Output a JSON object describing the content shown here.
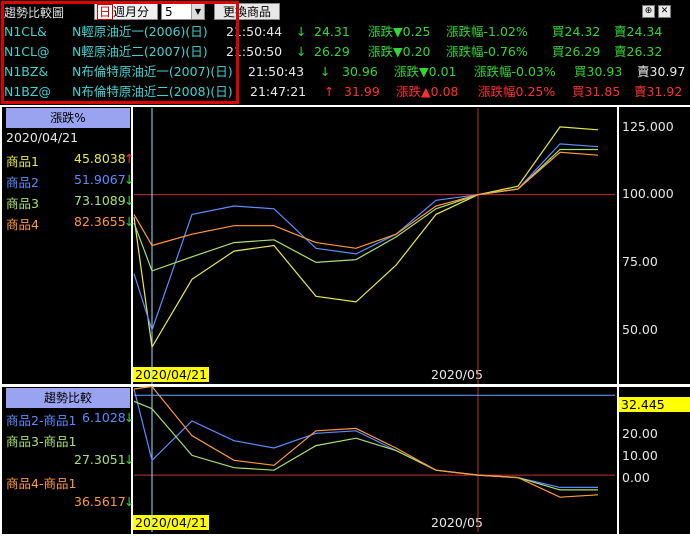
{
  "toolbar": {
    "title": "趨勢比較圖",
    "period_options": [
      "日",
      "週",
      "月",
      "分"
    ],
    "period_selected": "日",
    "count_value": "5",
    "change_button": "更換商品",
    "window_buttons": [
      "pin-icon",
      "close-icon"
    ]
  },
  "quotes": [
    {
      "code": "N1CL&",
      "name": "N輕原油近一(2006)(日)",
      "time": "21:50:44",
      "arrow": "↓",
      "price": "24.31",
      "chg_label": "漲跌",
      "chg_arrow": "▼",
      "chg": "0.25",
      "pct_label": "漲跌幅",
      "pct": "-1.02%",
      "bid_label": "買",
      "bid": "24.32",
      "ask_label": "賣",
      "ask": "24.34",
      "color": "green"
    },
    {
      "code": "N1CL@",
      "name": "N輕原油近二(2007)(日)",
      "time": "21:50:50",
      "arrow": "↓",
      "price": "26.29",
      "chg_label": "漲跌",
      "chg_arrow": "▼",
      "chg": "0.20",
      "pct_label": "漲跌幅",
      "pct": "-0.76%",
      "bid_label": "買",
      "bid": "26.29",
      "ask_label": "賣",
      "ask": "26.32",
      "color": "green"
    },
    {
      "code": "N1BZ&",
      "name": "N布倫特原油近一(2007)(日)",
      "time": "21:50:43",
      "arrow": "↓",
      "price": "30.96",
      "chg_label": "漲跌",
      "chg_arrow": "▼",
      "chg": "0.01",
      "pct_label": "漲跌幅",
      "pct": "-0.03%",
      "bid_label": "買",
      "bid": "30.93",
      "ask_label": "賣",
      "ask": "30.97",
      "color": "green"
    },
    {
      "code": "N1BZ@",
      "name": "N布倫特原油近二(2008)(日)",
      "time": "21:47:21",
      "arrow": "↑",
      "price": "31.99",
      "chg_label": "漲跌",
      "chg_arrow": "▲",
      "chg": "0.08",
      "pct_label": "漲跌幅",
      "pct": "0.25%",
      "bid_label": "買",
      "bid": "31.85",
      "ask_label": "賣",
      "ask": "31.92",
      "color": "red"
    }
  ],
  "top_panel": {
    "header": "漲跌%",
    "date": "2020/04/21",
    "items": [
      {
        "label": "商品1",
        "value": "45.8038",
        "arrow": "↑",
        "color": "#e8e84a"
      },
      {
        "label": "商品2",
        "value": "51.9067",
        "arrow": "↓",
        "color": "#5b8cff"
      },
      {
        "label": "商品3",
        "value": "73.1089",
        "arrow": "↓",
        "color": "#a8e070"
      },
      {
        "label": "商品4",
        "value": "82.3655",
        "arrow": "↓",
        "color": "#ff9a3c"
      }
    ],
    "y_ticks": [
      "125.000",
      "100.000",
      "75.00",
      "50.00"
    ],
    "x_labels": [
      "2020/04/21",
      "2020/05"
    ]
  },
  "bottom_panel": {
    "header": "趨勢比較",
    "items": [
      {
        "label": "商品2-商品1",
        "value": "6.1028",
        "arrow": "↓",
        "color": "#5b8cff"
      },
      {
        "label": "商品3-商品1",
        "value": "27.3051",
        "arrow": "↓",
        "color": "#a8e070"
      },
      {
        "label": "商品4-商品1",
        "value": "36.5617",
        "arrow": "↓",
        "color": "#ff9a3c"
      }
    ],
    "current_value": "32.445",
    "y_ticks": [
      "20.00",
      "10.00",
      "0.00"
    ],
    "x_labels": [
      "2020/04/21",
      "2020/05"
    ]
  },
  "chart_data": [
    {
      "type": "line",
      "ylim": [
        40,
        130
      ],
      "series": [
        {
          "name": "商品1",
          "color": "#e8e84a",
          "values": [
            92,
            46,
            70,
            80,
            82,
            64,
            62,
            75,
            93,
            100,
            103,
            124,
            123
          ]
        },
        {
          "name": "商品2",
          "color": "#5b8cff",
          "values": [
            72,
            52,
            93,
            96,
            95,
            81,
            79,
            86,
            98,
            100,
            102,
            118,
            117
          ]
        },
        {
          "name": "商品3",
          "color": "#a8e070",
          "values": [
            90,
            73,
            78,
            83,
            84,
            76,
            77,
            85,
            95,
            100,
            102,
            116,
            116
          ]
        },
        {
          "name": "商品4",
          "color": "#ff9a3c",
          "values": [
            93,
            82,
            86,
            89,
            89,
            83,
            81,
            86,
            96,
            100,
            102,
            115,
            114
          ]
        }
      ]
    },
    {
      "type": "line",
      "ylim": [
        -15,
        35
      ],
      "series": [
        {
          "name": "商品2-商品1",
          "color": "#5b8cff",
          "values": [
            35,
            6,
            22,
            14,
            11,
            17,
            18,
            10,
            2,
            0,
            -1,
            -5,
            -5
          ]
        },
        {
          "name": "商品3-商品1",
          "color": "#a8e070",
          "values": [
            30,
            27,
            8,
            3,
            2,
            12,
            15,
            10,
            2,
            0,
            -1,
            -6,
            -6
          ]
        },
        {
          "name": "商品4-商品1",
          "color": "#ff9a3c",
          "values": [
            35,
            36,
            16,
            6,
            4,
            18,
            19,
            11,
            2,
            0,
            -1,
            -9,
            -8
          ]
        }
      ]
    }
  ]
}
